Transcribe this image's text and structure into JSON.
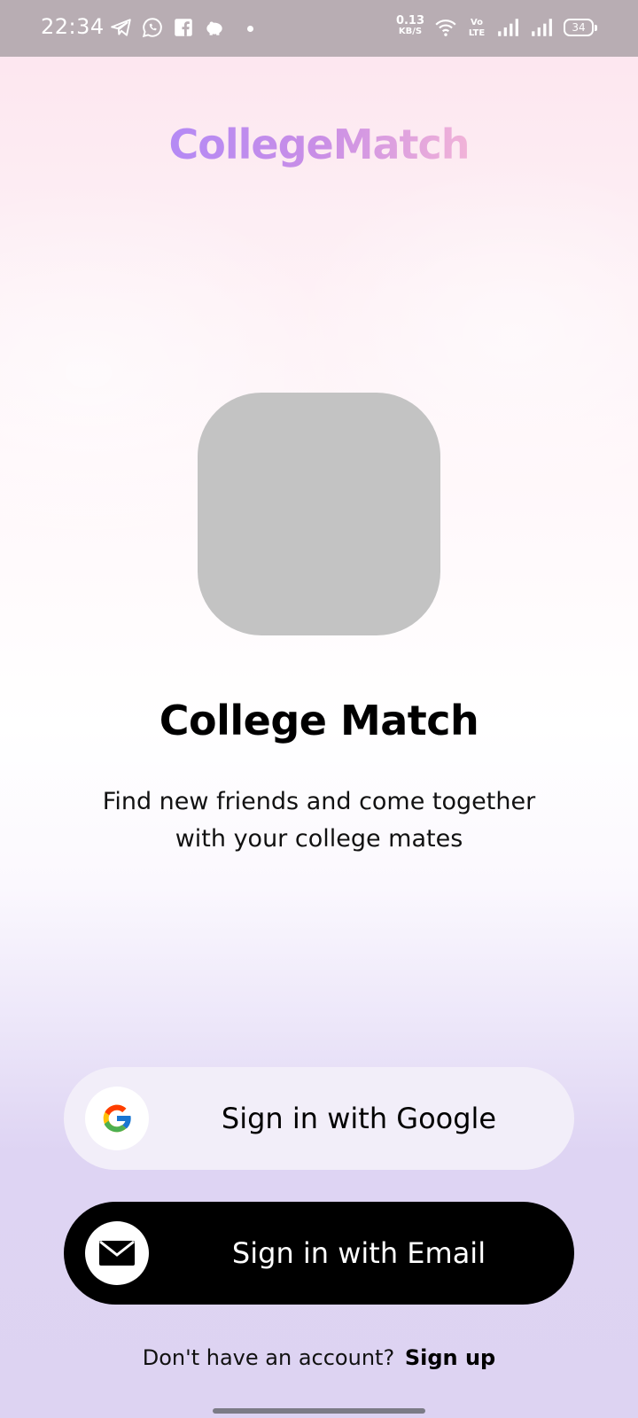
{
  "status_bar": {
    "time": "22:34",
    "net_speed_value": "0.13",
    "net_speed_unit": "KB/S",
    "volte": "Vo LTE",
    "battery": "34",
    "icons": [
      "telegram-icon",
      "whatsapp-icon",
      "facebook-icon",
      "piggy-bank-icon",
      "wifi-icon",
      "signal-icon",
      "signal-icon"
    ]
  },
  "brand": {
    "name": "CollegeMatch",
    "gradient": [
      "#b48af5",
      "#f1b3d8"
    ]
  },
  "app": {
    "title": "College Match",
    "tagline": "Find new friends and come together with your college mates"
  },
  "buttons": {
    "google_label": "Sign in with Google",
    "email_label": "Sign in with Email"
  },
  "footer": {
    "prompt": "Don't have an account?",
    "signup_label": "Sign up"
  },
  "colors": {
    "email_button": "#000000",
    "google_button": "#f2eef9",
    "logo_placeholder": "#c3c3c3"
  }
}
